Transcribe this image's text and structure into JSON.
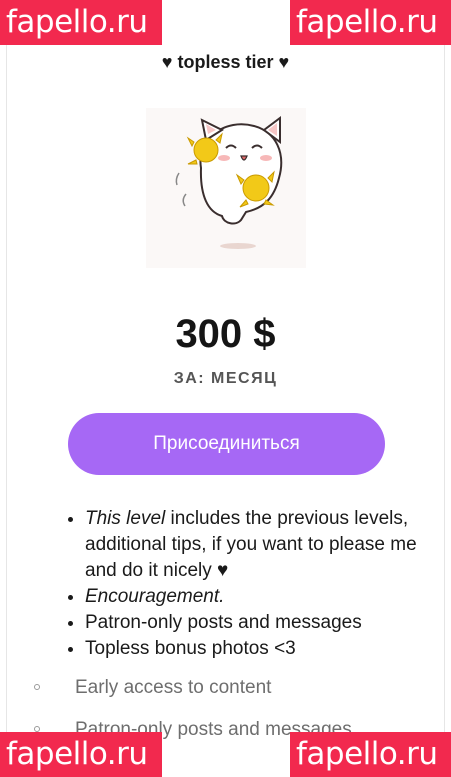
{
  "watermarks": {
    "top_left": "fapello.ru",
    "top_right": "fapello.ru",
    "bottom_left": "fapello.ru",
    "bottom_right": "fapello.ru"
  },
  "tier": {
    "title": "♥ topless tier ♥",
    "image_subject": "cartoon white cat cheering with yellow pom-poms",
    "price": "300 $",
    "period": "ЗА: МЕСЯЦ",
    "join_label": "Присоединиться"
  },
  "benefits": {
    "item1": {
      "italic": "This level",
      "rest": " includes the previous levels, additional tips, if you want to please me and do it nicely ♥"
    },
    "item2": "Encouragement.",
    "item3": "Patron-only posts and messages",
    "item4": "Topless bonus photos <3"
  },
  "sub_benefits": [
    "Early access to content",
    "Patron-only posts and messages"
  ],
  "colors": {
    "watermark_bg": "#f2294e",
    "button_bg": "#a668f5",
    "text_primary": "#1a1a1a",
    "text_muted": "#6e6e6e"
  }
}
